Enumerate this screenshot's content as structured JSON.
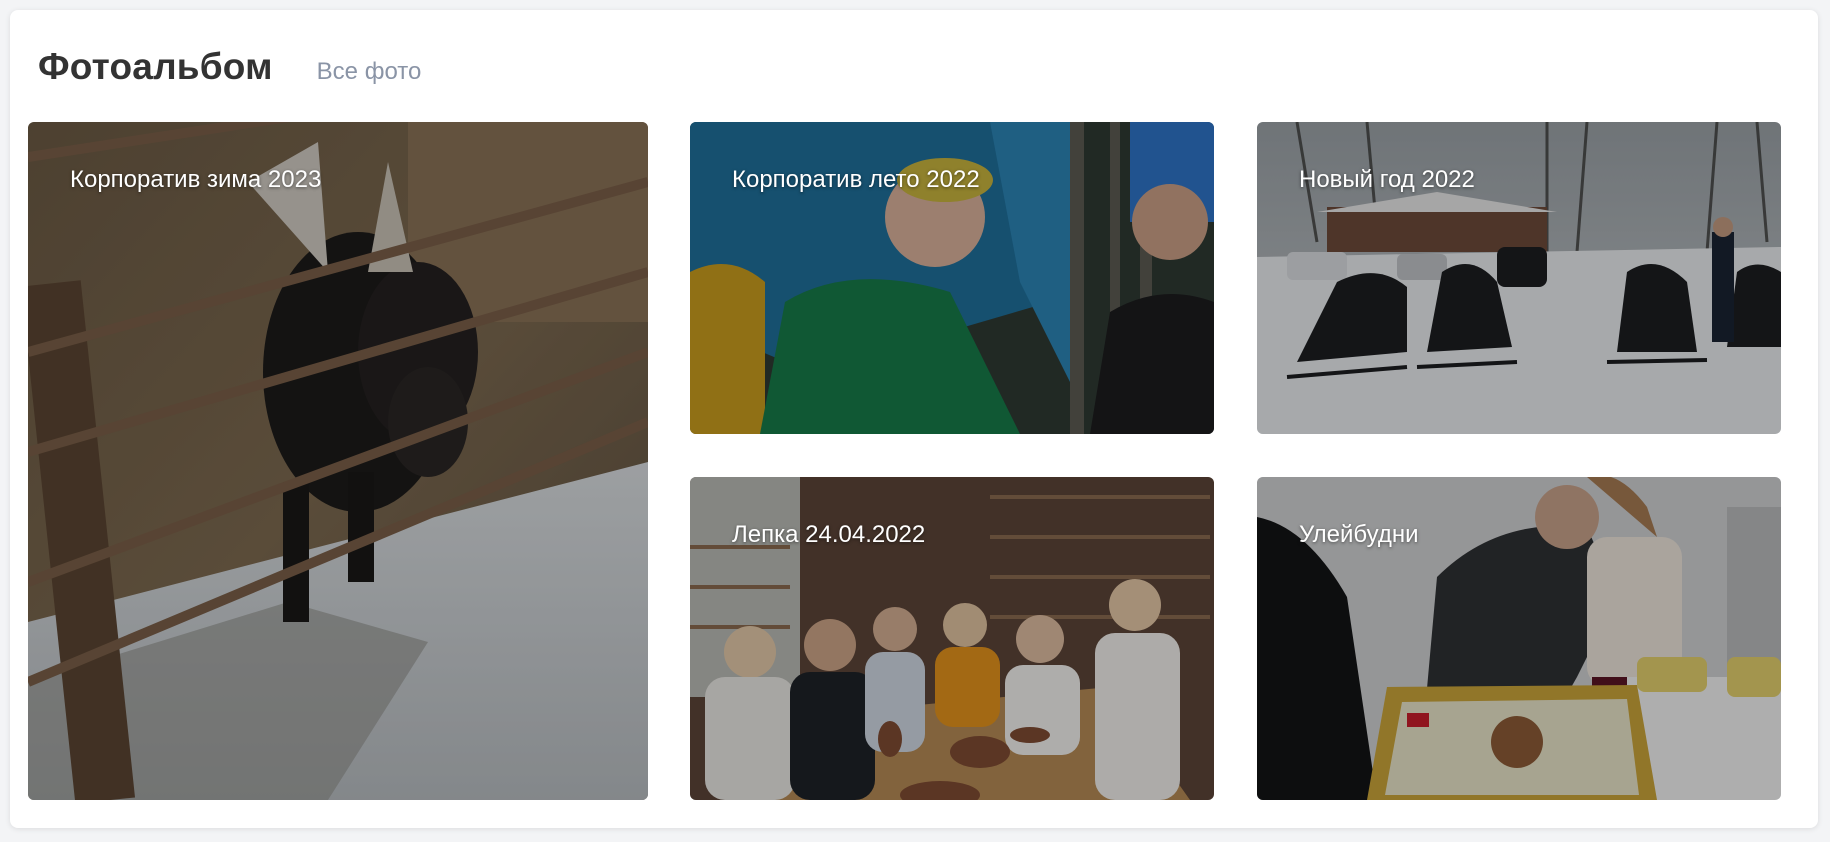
{
  "header": {
    "title": "Фотоальбом",
    "all_photos_link": "Все фото"
  },
  "albums": [
    {
      "label": "Корпоратив зима 2023",
      "scene": "goat-in-pen-photo"
    },
    {
      "label": "Корпоратив лето 2022",
      "scene": "summer-party-photo"
    },
    {
      "label": "Новый год 2022",
      "scene": "snowmobiles-photo"
    },
    {
      "label": "Лепка 24.04.2022",
      "scene": "pottery-class-photo"
    },
    {
      "label": "Улейбудни",
      "scene": "office-cake-photo"
    }
  ],
  "colors": {
    "title": "#333333",
    "link": "#8a94a6",
    "card_background": "#ffffff",
    "page_background": "#f3f4f6"
  }
}
